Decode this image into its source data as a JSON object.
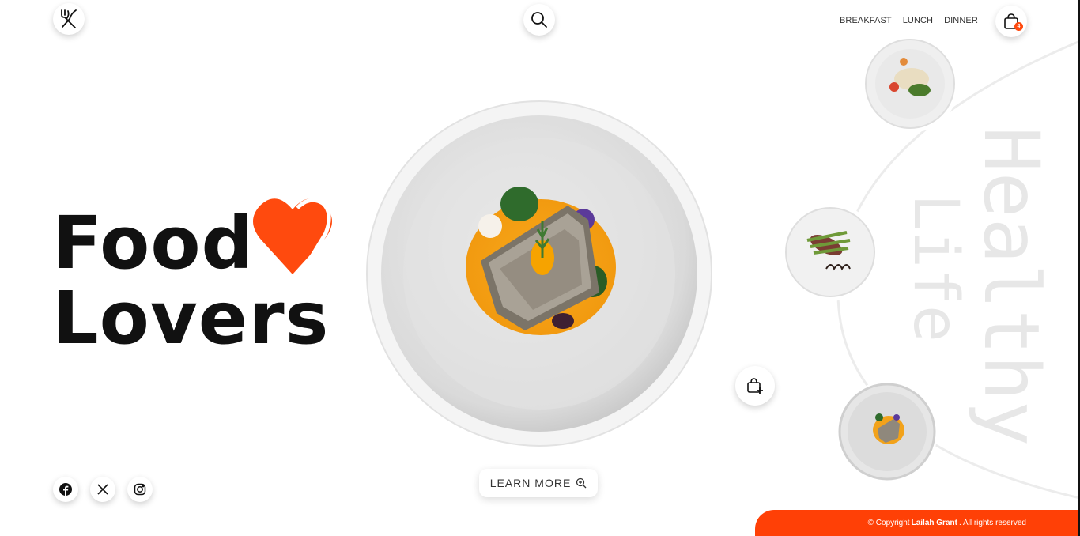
{
  "header": {
    "nav": [
      "BREAKFAST",
      "LUNCH",
      "DINNER"
    ],
    "cart_count": "4",
    "icons": {
      "logo": "fork-knife-icon",
      "search": "search-icon",
      "cart": "shopping-bag-icon"
    }
  },
  "hero": {
    "line1": "Food",
    "line2": "Lovers",
    "accent_color": "#ff4a0e",
    "learn_more": "LEARN MORE",
    "side_text_1": "Healthy",
    "side_text_2": "Life"
  },
  "social": [
    "facebook-icon",
    "x-icon",
    "instagram-icon"
  ],
  "footer": {
    "prefix": "© Copyright",
    "name": "Lailah Grant",
    "suffix": ". All rights reserved"
  }
}
